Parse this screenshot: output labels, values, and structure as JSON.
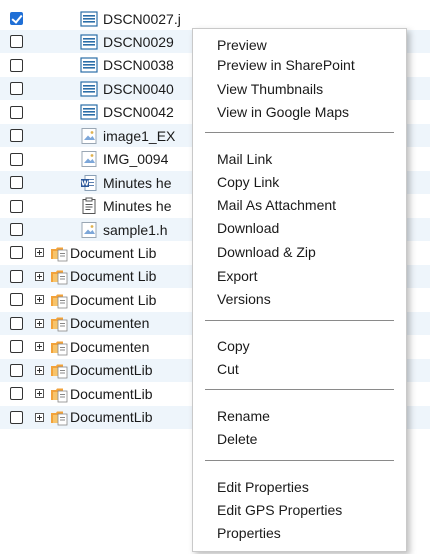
{
  "files": [
    {
      "name": "DSCN0027.j",
      "icon": "image-file-icon",
      "checked": true
    },
    {
      "name": "DSCN0029",
      "icon": "image-file-icon",
      "checked": false
    },
    {
      "name": "DSCN0038",
      "icon": "image-file-icon",
      "checked": false
    },
    {
      "name": "DSCN0040",
      "icon": "image-file-icon",
      "checked": false
    },
    {
      "name": "DSCN0042",
      "icon": "image-file-icon",
      "checked": false
    },
    {
      "name": "image1_EX",
      "icon": "image-thumb-icon",
      "checked": false
    },
    {
      "name": "IMG_0094",
      "icon": "image-thumb-icon",
      "checked": false
    },
    {
      "name": "Minutes he",
      "icon": "word-doc-icon",
      "checked": false
    },
    {
      "name": "Minutes he",
      "icon": "text-doc-icon",
      "checked": false
    },
    {
      "name": "sample1.h",
      "icon": "image-thumb-icon",
      "checked": false
    }
  ],
  "libraries": [
    {
      "name": "Document Lib",
      "icon": "document-library-icon"
    },
    {
      "name": "Document Lib",
      "icon": "document-library-icon"
    },
    {
      "name": "Document Lib",
      "icon": "document-library-icon"
    },
    {
      "name": "Documenten",
      "icon": "document-library-icon"
    },
    {
      "name": "Documenten",
      "icon": "document-library-icon"
    },
    {
      "name": "DocumentLib",
      "icon": "document-library-icon"
    },
    {
      "name": "DocumentLib",
      "icon": "document-library-icon"
    },
    {
      "name": "DocumentLib",
      "icon": "document-library-icon"
    }
  ],
  "context_menu": {
    "preview": "Preview",
    "preview_sharepoint": "Preview in SharePoint",
    "view_thumbnails": "View Thumbnails",
    "view_google_maps": "View in Google Maps",
    "mail_link": "Mail Link",
    "copy_link": "Copy Link",
    "mail_attachment": "Mail As Attachment",
    "download": "Download",
    "download_zip": "Download & Zip",
    "export": "Export",
    "versions": "Versions",
    "copy": "Copy",
    "cut": "Cut",
    "rename": "Rename",
    "delete": "Delete",
    "edit_properties": "Edit Properties",
    "edit_gps_properties": "Edit GPS Properties",
    "properties": "Properties"
  },
  "colors": {
    "row_alt": "#eef5fb",
    "checkbox_checked": "#1f6fd6",
    "menu_border": "#c9c9c9"
  }
}
